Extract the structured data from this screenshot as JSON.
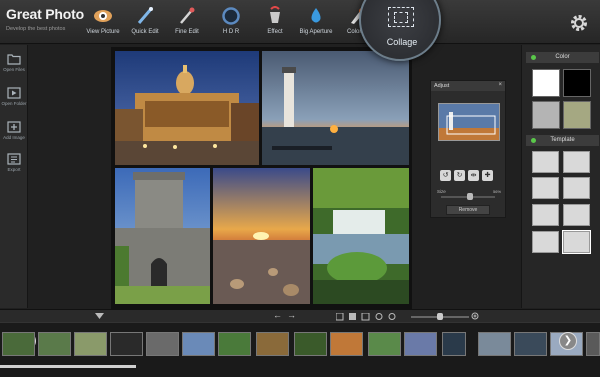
{
  "app": {
    "title": "Great Photo",
    "subtitle": "Develop the best photos"
  },
  "toolbar": {
    "items": [
      {
        "label": "View Picture",
        "icon": "eye-icon"
      },
      {
        "label": "Quick Edit",
        "icon": "wand-icon"
      },
      {
        "label": "Fine Edit",
        "icon": "magic-wand-icon"
      },
      {
        "label": "H D R",
        "icon": "hdr-ring-icon"
      },
      {
        "label": "Effect",
        "icon": "bucket-icon"
      },
      {
        "label": "Big Aperture",
        "icon": "drop-icon"
      },
      {
        "label": "Color S",
        "icon": "brush-icon"
      }
    ],
    "collage_label": "Collage",
    "settings_icon": "gear-icon"
  },
  "leftbar": {
    "items": [
      {
        "label": "Open Files",
        "icon": "folder-icon"
      },
      {
        "label": "Open Folder",
        "icon": "play-folder-icon"
      },
      {
        "label": "Add Image",
        "icon": "add-image-icon"
      },
      {
        "label": "Export",
        "icon": "export-icon"
      }
    ]
  },
  "adjust": {
    "title": "Adjust",
    "close": "×",
    "size_label": "Size",
    "size_value": "56%",
    "remove_label": "Remove",
    "buttons": [
      "↺",
      "↻",
      "⇹",
      "✚"
    ]
  },
  "rightpanel": {
    "color_title": "Color",
    "template_title": "Template",
    "colors": [
      "#ffffff",
      "#000000",
      "#b4b4b4",
      "#a5a882"
    ]
  },
  "bottombar": {
    "nav_prev": "←",
    "nav_next": "→"
  },
  "filmstrip": {
    "prev": "❮",
    "next": "❯"
  },
  "colors": {
    "accent": "#5ac84a",
    "toolbar_text": "#cfd6dd"
  }
}
